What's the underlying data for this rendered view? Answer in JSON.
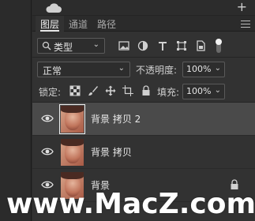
{
  "tabs": [
    {
      "label": "图层",
      "active": true
    },
    {
      "label": "通道",
      "active": false
    },
    {
      "label": "路径",
      "active": false
    }
  ],
  "filter": {
    "kind_label": "类型",
    "icons": [
      "image-filter-icon",
      "adjustment-filter-icon",
      "type-filter-icon",
      "shape-filter-icon",
      "smart-object-filter-icon",
      "filter-toggle-icon"
    ]
  },
  "blend": {
    "mode": "正常",
    "opacity_label": "不透明度:",
    "opacity_value": "100%"
  },
  "lock": {
    "label": "锁定:",
    "icons": [
      "lock-transparent-icon",
      "lock-brush-icon",
      "lock-move-icon",
      "lock-artboard-icon",
      "lock-all-icon"
    ],
    "fill_label": "填充:",
    "fill_value": "100%"
  },
  "layers": [
    {
      "name": "背景 拷贝 2",
      "selected": true,
      "locked": false
    },
    {
      "name": "背景 拷贝",
      "selected": false,
      "locked": false
    },
    {
      "name": "背景",
      "selected": false,
      "locked": true
    }
  ],
  "watermark": "www.MacZ.com",
  "colors": {
    "panel": "#323232",
    "selected_row": "#4a4a4a",
    "text": "#e8e8e8"
  }
}
